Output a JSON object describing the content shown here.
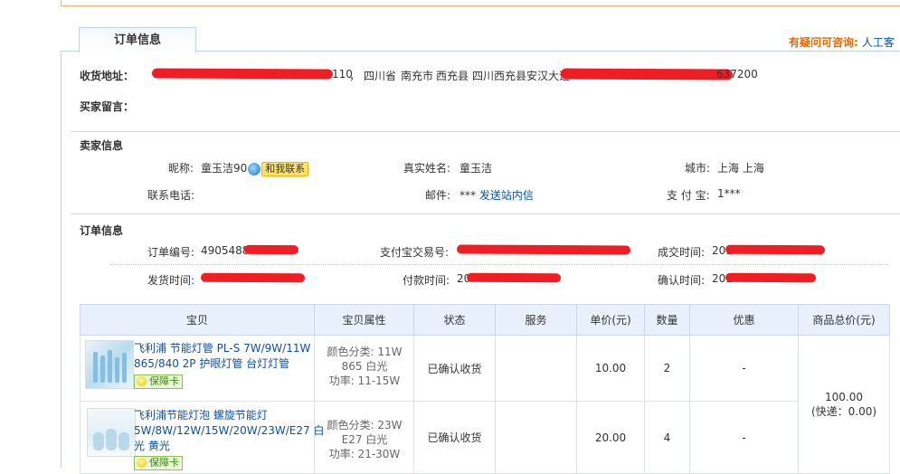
{
  "tab": {
    "label": "订单信息"
  },
  "help": {
    "question": "有疑问可咨询:",
    "link": "人工客"
  },
  "address": {
    "label": "收货地址：",
    "phone_suffix": "110",
    "province": "四川省",
    "city": "南充市",
    "district": "西充县",
    "street": "四川西充县安汉大道",
    "zip_suffix": "637200"
  },
  "message": {
    "label": "买家留言："
  },
  "seller": {
    "section_title": "卖家信息",
    "nickname_label": "昵称:",
    "nickname": "童玉洁90",
    "contact_button": "和我联系",
    "realname_label": "真实姓名:",
    "realname": "童玉洁",
    "city_label": "城市:",
    "city": "上海 上海",
    "phone_label": "联系电话:",
    "email_label": "邮件:",
    "email_value": "***",
    "email_link": "发送站内信",
    "alipay_label": "支 付 宝:",
    "alipay_value": "1***"
  },
  "order": {
    "section_title": "订单信息",
    "order_no_label": "订单编号:",
    "order_no_prefix": "4905488",
    "alipay_trade_label": "支付宝交易号:",
    "deal_time_label": "成交时间:",
    "deal_time_prefix": "201",
    "ship_time_label": "发货时间:",
    "pay_time_label": "付款时间:",
    "pay_time_prefix": "20",
    "confirm_time_label": "确认时间:",
    "confirm_time_prefix": "201"
  },
  "table": {
    "headers": [
      "宝贝",
      "宝贝属性",
      "状态",
      "服务",
      "单价(元)",
      "数量",
      "优惠",
      "商品总价(元)"
    ],
    "rows": [
      {
        "title_lines": [
          "飞利浦 节能灯管 PL-S 7W/9W/11W",
          "865/840 2P 护眼灯管 台灯灯管"
        ],
        "badge": "保障卡",
        "attr_lines": [
          "颜色分类: 11W",
          "865 白光",
          "功率: 11-15W"
        ],
        "status": "已确认收货",
        "service": "",
        "price": "10.00",
        "qty": "2",
        "discount": "-"
      },
      {
        "title_lines": [
          "飞利浦节能灯泡 螺旋节能灯",
          "5W/8W/12W/15W/20W/23W/E27 白",
          "光 黄光"
        ],
        "badge": "保障卡",
        "attr_lines": [
          "颜色分类: 23W",
          "E27 白光",
          "功率: 21-30W"
        ],
        "status": "已确认收货",
        "service": "",
        "price": "20.00",
        "qty": "4",
        "discount": "-"
      }
    ],
    "total": "100.00",
    "shipping": "(快递：0.00)"
  },
  "colors": {
    "accent_blue": "#0b52a2",
    "warning_orange": "#e56a00",
    "redaction": "#ee1e24",
    "header_bg": "#e7f0fb"
  }
}
